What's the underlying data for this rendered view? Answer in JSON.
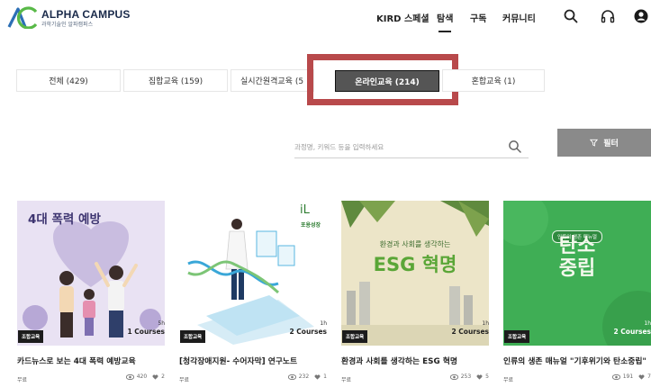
{
  "header": {
    "brand": "ALPHA CAMPUS",
    "brand_sub": "과학기술인 알파캠퍼스",
    "nav": [
      "KIRD 스페셜",
      "탐색",
      "구독",
      "커뮤니티"
    ],
    "active_nav": "탐색",
    "icons": [
      "search-icon",
      "headphones-icon",
      "user-icon"
    ]
  },
  "categories": [
    {
      "label": "전체 (429)"
    },
    {
      "label": "집합교육 (159)"
    },
    {
      "label": "실시간원격교육 (5"
    },
    {
      "label": "온라인교육 (214)"
    },
    {
      "label": "혼합교육 (1)"
    }
  ],
  "active_category": "온라인교육 (214)",
  "search": {
    "placeholder": "과정명, 키워드 등을 입력하세요"
  },
  "filter": {
    "label": "필터",
    "icon": "funnel-icon"
  },
  "courses": [
    {
      "thumb_text": "4대 폭력 예방",
      "tag": "조합교육",
      "duration": "5h",
      "count": "1 Courses",
      "title": "카드뉴스로 보는 4대 폭력 예방교육",
      "price": "무료",
      "views": "420",
      "likes": "2"
    },
    {
      "thumb_text": "포용성장",
      "tag": "조합교육",
      "duration": "1h",
      "count": "2 Courses",
      "title": "[청각장애지원- 수어자막] 연구노트",
      "price": "무료",
      "views": "232",
      "likes": "1"
    },
    {
      "thumb_text_small": "환경과 사회를 생각하는",
      "thumb_text": "ESG 혁명",
      "tag": "조합교육",
      "duration": "1h",
      "count": "2 Courses",
      "title": "환경과 사회를 생각하는 ESG 혁명",
      "price": "무료",
      "views": "253",
      "likes": "5"
    },
    {
      "thumb_badge": "인류의 생존 매뉴얼",
      "thumb_line1": "탄소",
      "thumb_line2": "중립",
      "tag": "조합교육",
      "duration": "1h",
      "count": "2 Courses",
      "title": "인류의 생존 매뉴얼 \"기후위기와 탄소중립\"",
      "price": "무료",
      "views": "191",
      "likes": "7"
    }
  ],
  "colors": {
    "highlight": "#b8494b",
    "active_tab": "#555555",
    "filter_button": "#8a8a8a",
    "logo_blue": "#2c6fb5",
    "logo_green": "#58b947"
  }
}
